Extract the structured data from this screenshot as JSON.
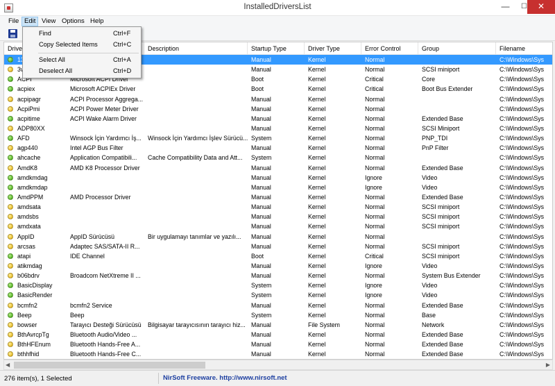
{
  "window": {
    "title": "InstalledDriversList",
    "min_glyph": "—",
    "max_glyph": "☐",
    "close_glyph": "✕"
  },
  "menu": [
    "File",
    "Edit",
    "View",
    "Options",
    "Help"
  ],
  "edit_menu": [
    {
      "label": "Find",
      "shortcut": "Ctrl+F"
    },
    {
      "label": "Copy Selected Items",
      "shortcut": "Ctrl+C"
    },
    {
      "label": "Select All",
      "shortcut": "Ctrl+A"
    },
    {
      "label": "Deselect All",
      "shortcut": "Ctrl+D"
    }
  ],
  "columns": [
    "Driver",
    "",
    "Description",
    "Startup Type",
    "Driver Type",
    "Error Control",
    "Group",
    "Filename"
  ],
  "rows": [
    {
      "dot": "green",
      "cells": [
        "1394ohci",
        "",
        "",
        "Manual",
        "Kernel",
        "Normal",
        "",
        "C:\\Windows\\Sys"
      ]
    },
    {
      "dot": "yellow",
      "cells": [
        "3ware",
        "",
        "",
        "Manual",
        "Kernel",
        "Normal",
        "SCSI miniport",
        "C:\\Windows\\Sys"
      ]
    },
    {
      "dot": "green",
      "cells": [
        "ACPI",
        "Microsoft ACPI Driver",
        "",
        "Boot",
        "Kernel",
        "Critical",
        "Core",
        "C:\\Windows\\Sys"
      ]
    },
    {
      "dot": "green",
      "cells": [
        "acpiex",
        "Microsoft ACPIEx Driver",
        "",
        "Boot",
        "Kernel",
        "Critical",
        "Boot Bus Extender",
        "C:\\Windows\\Sys"
      ]
    },
    {
      "dot": "yellow",
      "cells": [
        "acpipagr",
        "ACPI Processor Aggrega...",
        "",
        "Manual",
        "Kernel",
        "Normal",
        "",
        "C:\\Windows\\Sys"
      ]
    },
    {
      "dot": "yellow",
      "cells": [
        "AcpiPmi",
        "ACPI Power Meter Driver",
        "",
        "Manual",
        "Kernel",
        "Normal",
        "",
        "C:\\Windows\\Sys"
      ]
    },
    {
      "dot": "green",
      "cells": [
        "acpitime",
        "ACPI Wake Alarm Driver",
        "",
        "Manual",
        "Kernel",
        "Normal",
        "Extended Base",
        "C:\\Windows\\Sys"
      ]
    },
    {
      "dot": "yellow",
      "cells": [
        "ADP80XX",
        "",
        "",
        "Manual",
        "Kernel",
        "Normal",
        "SCSI Miniport",
        "C:\\Windows\\Sys"
      ]
    },
    {
      "dot": "green",
      "cells": [
        "AFD",
        "Winsock İçin Yardımcı İş...",
        "Winsock İçin Yardımcı İşlev Sürücü...",
        "System",
        "Kernel",
        "Normal",
        "PNP_TDI",
        "C:\\Windows\\Sys"
      ]
    },
    {
      "dot": "yellow",
      "cells": [
        "agp440",
        "Intel AGP Bus Filter",
        "",
        "Manual",
        "Kernel",
        "Normal",
        "PnP Filter",
        "C:\\Windows\\Sys"
      ]
    },
    {
      "dot": "green",
      "cells": [
        "ahcache",
        "Application Compatibili...",
        "Cache Compatibility Data and Att...",
        "System",
        "Kernel",
        "Normal",
        "",
        "C:\\Windows\\Sys"
      ]
    },
    {
      "dot": "yellow",
      "cells": [
        "AmdK8",
        "AMD K8 Processor Driver",
        "",
        "Manual",
        "Kernel",
        "Normal",
        "Extended Base",
        "C:\\Windows\\Sys"
      ]
    },
    {
      "dot": "green",
      "cells": [
        "amdkmdag",
        "",
        "",
        "Manual",
        "Kernel",
        "Ignore",
        "Video",
        "C:\\Windows\\Sys"
      ]
    },
    {
      "dot": "green",
      "cells": [
        "amdkmdap",
        "",
        "",
        "Manual",
        "Kernel",
        "Ignore",
        "Video",
        "C:\\Windows\\Sys"
      ]
    },
    {
      "dot": "green",
      "cells": [
        "AmdPPM",
        "AMD Processor Driver",
        "",
        "Manual",
        "Kernel",
        "Normal",
        "Extended Base",
        "C:\\Windows\\Sys"
      ]
    },
    {
      "dot": "yellow",
      "cells": [
        "amdsata",
        "",
        "",
        "Manual",
        "Kernel",
        "Normal",
        "SCSI miniport",
        "C:\\Windows\\Sys"
      ]
    },
    {
      "dot": "yellow",
      "cells": [
        "amdsbs",
        "",
        "",
        "Manual",
        "Kernel",
        "Normal",
        "SCSI miniport",
        "C:\\Windows\\Sys"
      ]
    },
    {
      "dot": "yellow",
      "cells": [
        "amdxata",
        "",
        "",
        "Manual",
        "Kernel",
        "Normal",
        "SCSI miniport",
        "C:\\Windows\\Sys"
      ]
    },
    {
      "dot": "yellow",
      "cells": [
        "AppID",
        "AppID Sürücüsü",
        "Bir uygulamayı tanımlar ve yazılı...",
        "Manual",
        "Kernel",
        "Normal",
        "",
        "C:\\Windows\\Sys"
      ]
    },
    {
      "dot": "yellow",
      "cells": [
        "arcsas",
        "Adaptec SAS/SATA-II R...",
        "",
        "Manual",
        "Kernel",
        "Normal",
        "SCSI miniport",
        "C:\\Windows\\Sys"
      ]
    },
    {
      "dot": "green",
      "cells": [
        "atapi",
        "IDE Channel",
        "",
        "Boot",
        "Kernel",
        "Critical",
        "SCSI miniport",
        "C:\\Windows\\Sys"
      ]
    },
    {
      "dot": "yellow",
      "cells": [
        "atikmdag",
        "",
        "",
        "Manual",
        "Kernel",
        "Ignore",
        "Video",
        "C:\\Windows\\Sys"
      ]
    },
    {
      "dot": "yellow",
      "cells": [
        "b06bdrv",
        "Broadcom NetXtreme II ...",
        "",
        "Manual",
        "Kernel",
        "Normal",
        "System Bus Extender",
        "C:\\Windows\\Sys"
      ]
    },
    {
      "dot": "green",
      "cells": [
        "BasicDisplay",
        "",
        "",
        "System",
        "Kernel",
        "Ignore",
        "Video",
        "C:\\Windows\\Sys"
      ]
    },
    {
      "dot": "green",
      "cells": [
        "BasicRender",
        "",
        "",
        "System",
        "Kernel",
        "Ignore",
        "Video",
        "C:\\Windows\\Sys"
      ]
    },
    {
      "dot": "yellow",
      "cells": [
        "bcmfn2",
        "bcmfn2 Service",
        "",
        "Manual",
        "Kernel",
        "Normal",
        "Extended Base",
        "C:\\Windows\\Sys"
      ]
    },
    {
      "dot": "green",
      "cells": [
        "Beep",
        "Beep",
        "",
        "System",
        "Kernel",
        "Normal",
        "Base",
        "C:\\Windows\\Sys"
      ]
    },
    {
      "dot": "yellow",
      "cells": [
        "bowser",
        "Tarayıcı Desteği Sürücüsü",
        "Bilgisayar tarayıcısının tarayıcı hiz...",
        "Manual",
        "File System",
        "Normal",
        "Network",
        "C:\\Windows\\Sys"
      ]
    },
    {
      "dot": "yellow",
      "cells": [
        "BthAvrcpTg",
        "Bluetooth Audio/Video ...",
        "",
        "Manual",
        "Kernel",
        "Normal",
        "Extended Base",
        "C:\\Windows\\Sys"
      ]
    },
    {
      "dot": "yellow",
      "cells": [
        "BthHFEnum",
        "Bluetooth Hands-Free A...",
        "",
        "Manual",
        "Kernel",
        "Normal",
        "Extended Base",
        "C:\\Windows\\Sys"
      ]
    },
    {
      "dot": "yellow",
      "cells": [
        "bthhfhid",
        "Bluetooth Hands-Free C...",
        "",
        "Manual",
        "Kernel",
        "Normal",
        "Extended Base",
        "C:\\Windows\\Sys"
      ]
    }
  ],
  "status": {
    "count": "276 item(s), 1 Selected",
    "credit": "NirSoft Freeware.  http://www.nirsoft.net"
  },
  "scroll": {
    "left_arrow": "◀",
    "right_arrow": "▶"
  },
  "colors": {
    "selection": "#3399ff",
    "close_button": "#c7302f",
    "link": "#1c3ea0"
  }
}
